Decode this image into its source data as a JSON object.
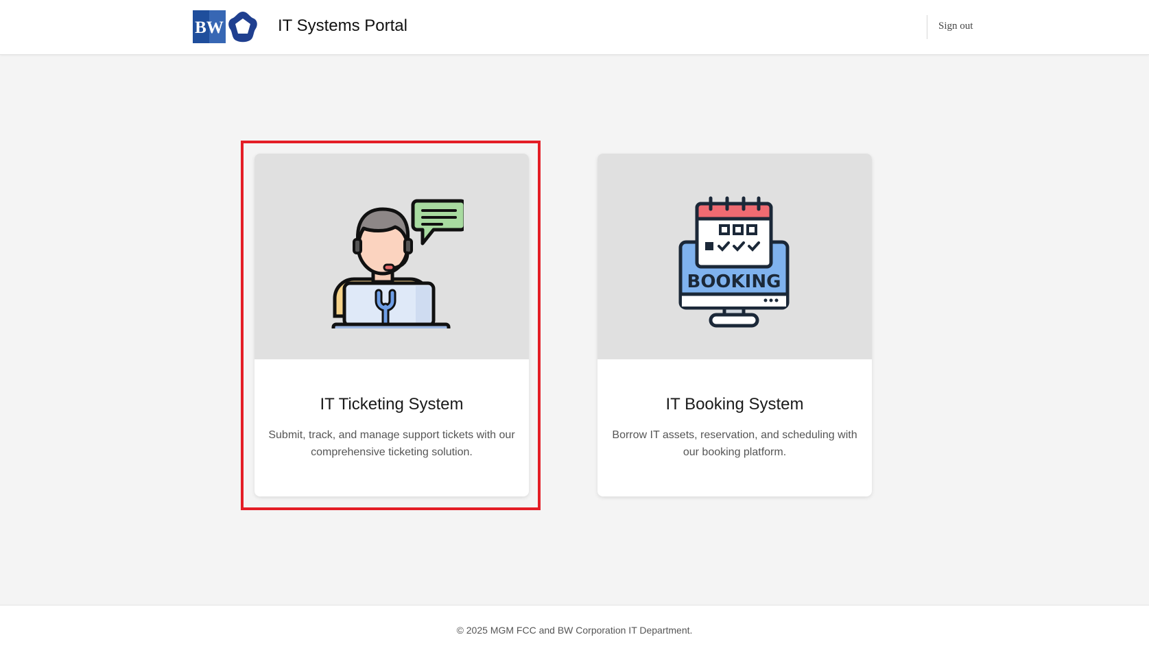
{
  "header": {
    "logo_text": "BW",
    "title": "IT Systems Portal",
    "signout_label": "Sign out"
  },
  "cards": [
    {
      "title": "IT Ticketing System",
      "description": "Submit, track, and manage support tickets with our comprehensive ticketing solution.",
      "icon": "support-agent-icon",
      "highlighted": true
    },
    {
      "title": "IT Booking System",
      "description": "Borrow IT assets, reservation, and scheduling with our booking platform.",
      "icon": "booking-monitor-icon",
      "icon_text": "BOOKING",
      "highlighted": false
    }
  ],
  "footer": {
    "copyright": "© 2025 MGM FCC and BW Corporation IT Department."
  },
  "colors": {
    "highlight_border": "#e41e26",
    "logo_blue": "#1f4e9c",
    "page_bg": "#f4f4f4"
  }
}
